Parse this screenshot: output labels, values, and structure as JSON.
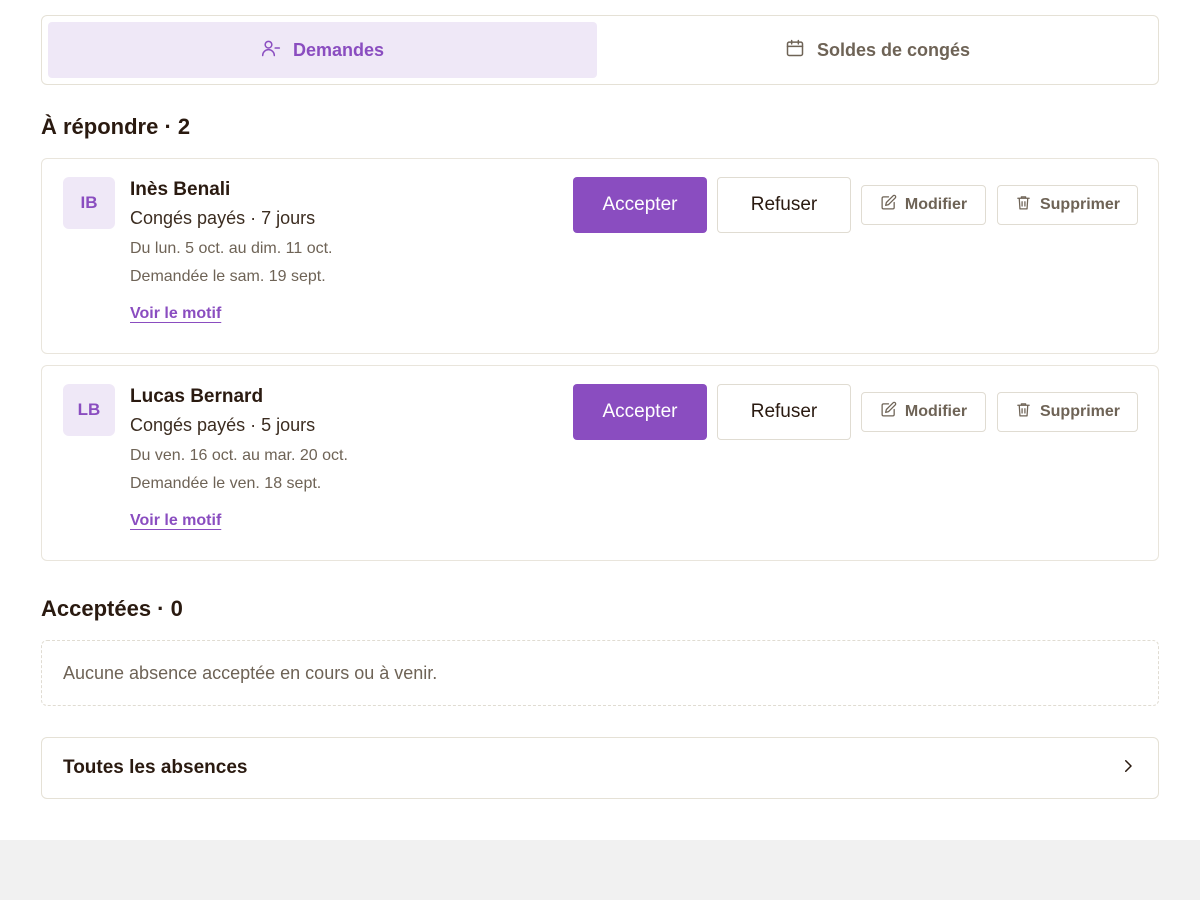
{
  "tabs": [
    {
      "label": "Demandes",
      "icon": "user-minus-icon",
      "active": true
    },
    {
      "label": "Soldes de congés",
      "icon": "calendar-icon",
      "active": false
    }
  ],
  "pending": {
    "title": "À répondre · 2",
    "requests": [
      {
        "initials": "IB",
        "name": "Inès Benali",
        "type": "Congés payés · 7 jours",
        "dates": "Du lun. 5 oct. au dim. 11 oct.",
        "requested": "Demandée le sam. 19 sept.",
        "motif_link": "Voir le motif"
      },
      {
        "initials": "LB",
        "name": "Lucas Bernard",
        "type": "Congés payés · 5 jours",
        "dates": "Du ven. 16 oct. au mar. 20 oct.",
        "requested": "Demandée le ven. 18 sept.",
        "motif_link": "Voir le motif"
      }
    ]
  },
  "actions": {
    "accept": "Accepter",
    "refuse": "Refuser",
    "modify": "Modifier",
    "delete": "Supprimer"
  },
  "accepted": {
    "title": "Acceptées · 0",
    "empty_message": "Aucune absence acceptée en cours ou à venir."
  },
  "all_absences": {
    "label": "Toutes les absences"
  },
  "colors": {
    "accent": "#8a4dc0",
    "accent_bg": "#efe8f7",
    "text": "#2a1a10",
    "muted": "#6e6356",
    "border": "#e5e1d6"
  }
}
